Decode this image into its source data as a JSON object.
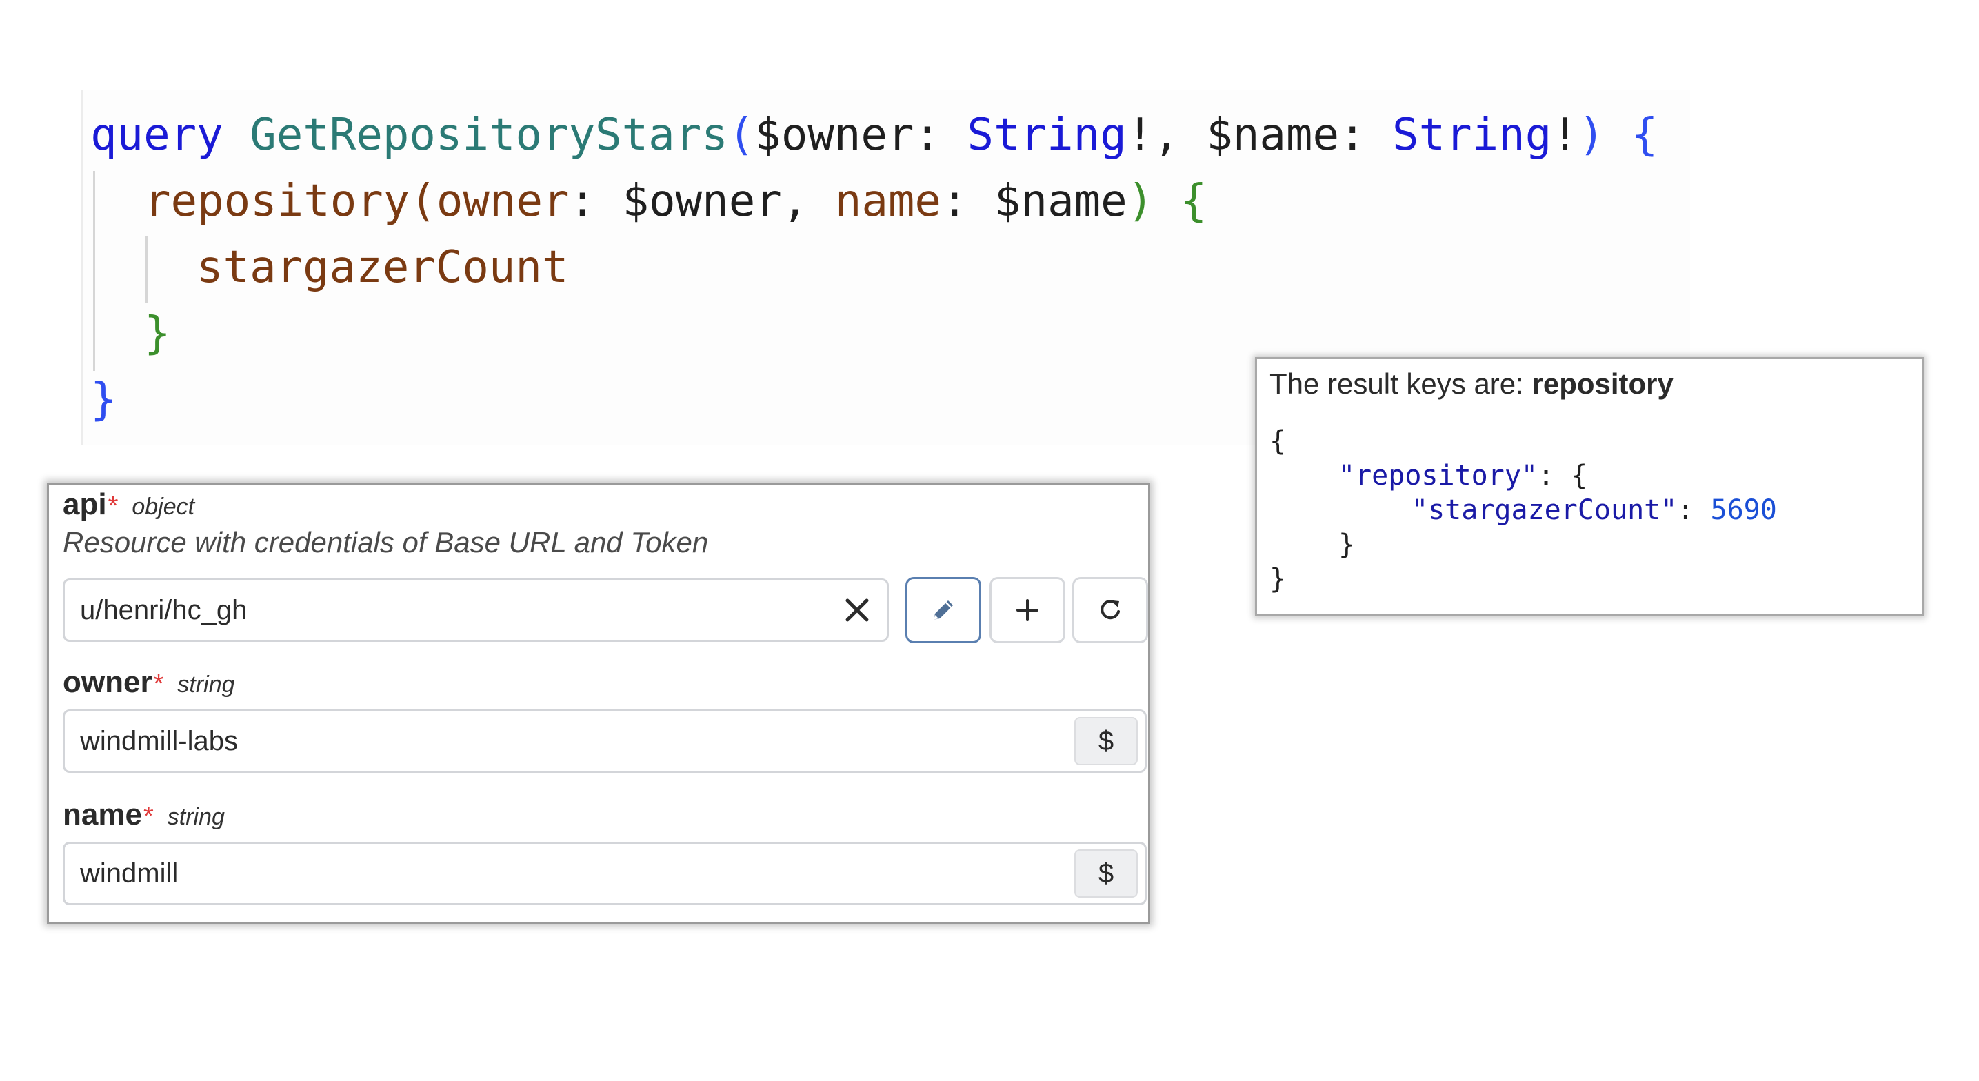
{
  "code": {
    "line1": {
      "keyword": "query",
      "op_name": "GetRepositoryStars",
      "open_paren": "(",
      "var1": "$owner",
      "colon1": ": ",
      "type1": "String",
      "bang1": "!, ",
      "var2": "$name",
      "colon2": ": ",
      "type2": "String",
      "bang2": "!",
      "close_paren": ")",
      "open_brace": "{"
    },
    "line2": {
      "field": "repository",
      "open_paren": "(",
      "arg1": "owner",
      "colon1": ": ",
      "val1": "$owner",
      "comma": ", ",
      "arg2": "name",
      "colon2": ": ",
      "val2": "$name",
      "close_paren": ")",
      "open_brace": "{"
    },
    "line3": {
      "field": "stargazerCount"
    },
    "line4": {
      "close_brace": "}"
    },
    "line5": {
      "close_brace": "}"
    }
  },
  "form": {
    "api": {
      "name": "api",
      "required_mark": "*",
      "type": "object",
      "description": "Resource with credentials of Base URL and Token",
      "value": "u/henri/hc_gh",
      "clear_icon": "close-icon",
      "edit_icon": "pencil-icon",
      "add_icon": "plus-icon",
      "refresh_icon": "refresh-icon"
    },
    "owner": {
      "name": "owner",
      "required_mark": "*",
      "type": "string",
      "value": "windmill-labs",
      "dollar_label": "$"
    },
    "name": {
      "name": "name",
      "required_mark": "*",
      "type": "string",
      "value": "windmill",
      "dollar_label": "$"
    },
    "colors": {
      "required": "#e03a3a",
      "primary_border": "#5a7fb0"
    }
  },
  "result": {
    "title_prefix": "The result keys are: ",
    "title_keys": "repository",
    "json": {
      "open": "{",
      "key1": "\"repository\"",
      "after_key1": ": {",
      "key2": "\"stargazerCount\"",
      "after_key2": ": ",
      "value2": "5690",
      "inner_close": "}",
      "outer_close": "}"
    }
  }
}
